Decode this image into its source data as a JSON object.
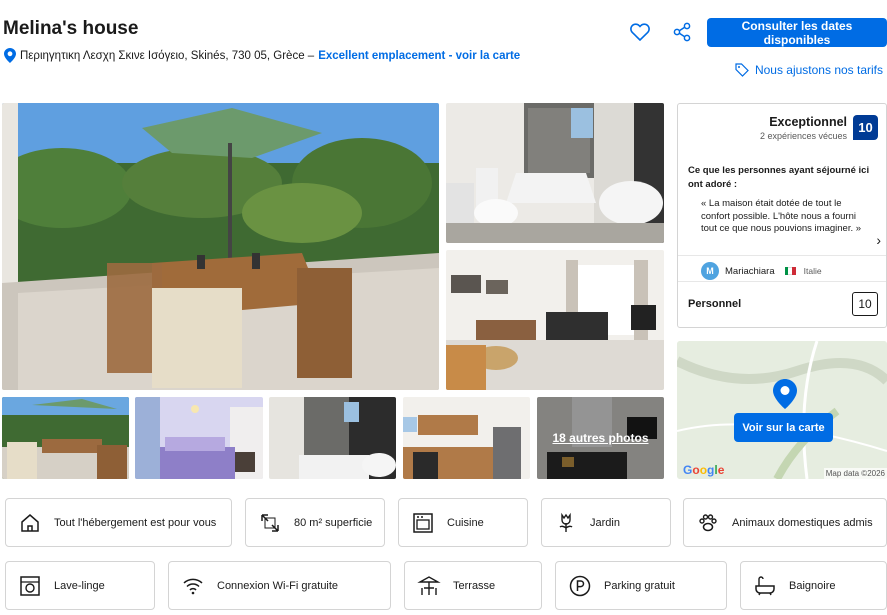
{
  "header": {
    "title": "Melina's house",
    "address": "Περιηγητικη Λεσχη Σκινε Ισόγειο, Skinés, 730 05, Grèce –",
    "location_link": "Excellent emplacement - voir la carte",
    "cta_button": "Consulter les dates disponibles",
    "price_match": "Nous ajustons nos tarifs"
  },
  "gallery": {
    "more_photos": "18 autres photos"
  },
  "review": {
    "label": "Exceptionnel",
    "count": "2 expériences vécues",
    "score": "10",
    "intro": "Ce que les personnes ayant séjourné ici ont adoré :",
    "quote": "« La maison était dotée de tout le confort possible. L'hôte nous a fourni tout ce que nous pouvions imaginer. »",
    "reviewer_initial": "M",
    "reviewer_name": "Mariachiara",
    "reviewer_country": "Italie",
    "category_label": "Personnel",
    "category_score": "10"
  },
  "map": {
    "button": "Voir sur la carte",
    "brand": "Google",
    "attribution": "Map data ©2026"
  },
  "facilities": [
    {
      "label": "Tout l'hébergement est pour vous",
      "icon": "house-icon"
    },
    {
      "label": "80 m² superficie",
      "icon": "expand-icon"
    },
    {
      "label": "Cuisine",
      "icon": "oven-icon"
    },
    {
      "label": "Jardin",
      "icon": "flower-icon"
    },
    {
      "label": "Animaux domestiques admis",
      "icon": "paw-icon"
    },
    {
      "label": "Lave-linge",
      "icon": "washing-machine-icon"
    },
    {
      "label": "Connexion Wi-Fi gratuite",
      "icon": "wifi-icon"
    },
    {
      "label": "Terrasse",
      "icon": "terrace-icon"
    },
    {
      "label": "Parking gratuit",
      "icon": "parking-icon"
    },
    {
      "label": "Baignoire",
      "icon": "bathtub-icon"
    }
  ],
  "colors": {
    "brand_blue": "#006ce4",
    "score_navy": "#003b95"
  }
}
